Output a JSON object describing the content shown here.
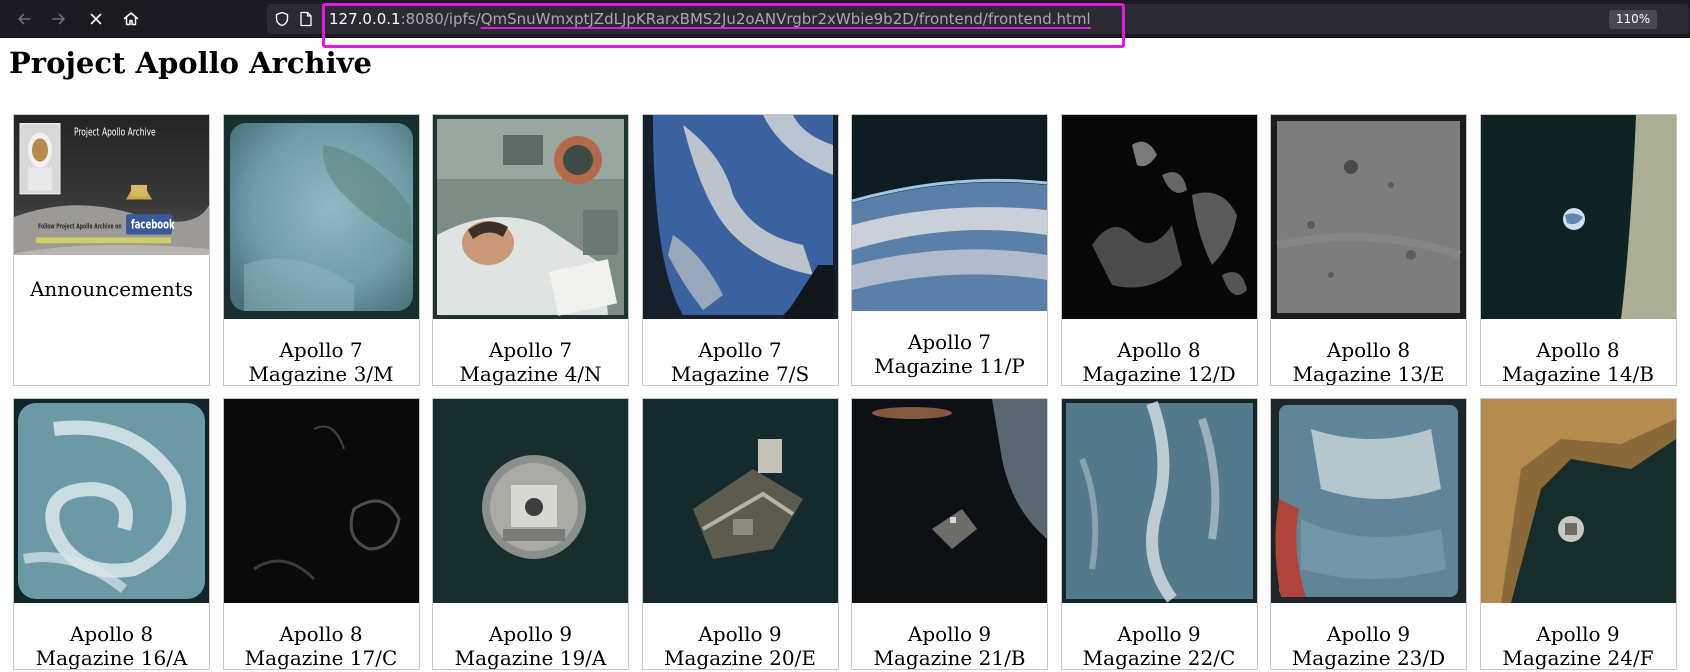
{
  "browser": {
    "url_host": "127.0.0.1",
    "url_port_prefix": ":8080/ipfs/",
    "url_path": "QmSnuWmxptJZdLJpKRarxBMS2Ju2oANVrgbr2xWbie9b2D/frontend/frontend.html",
    "zoom": "110%",
    "icons": [
      "back-arrow-icon",
      "forward-arrow-icon",
      "stop-loading-icon",
      "home-icon",
      "shield-icon",
      "page-icon"
    ]
  },
  "page": {
    "title": "Project Apollo Archive",
    "announcement": {
      "label": "Announcements",
      "banner_title": "Project Apollo Archive",
      "banner_follow": "Follow Project Apollo Archive on",
      "banner_brand": "facebook"
    },
    "albums": [
      {
        "mission": "Apollo 7",
        "magazine": "Magazine 3/M"
      },
      {
        "mission": "Apollo 7",
        "magazine": "Magazine 4/N"
      },
      {
        "mission": "Apollo 7",
        "magazine": "Magazine 7/S"
      },
      {
        "mission": "Apollo 7",
        "magazine": "Magazine 11/P"
      },
      {
        "mission": "Apollo 8",
        "magazine": "Magazine 12/D"
      },
      {
        "mission": "Apollo 8",
        "magazine": "Magazine 13/E"
      },
      {
        "mission": "Apollo 8",
        "magazine": "Magazine 14/B"
      },
      {
        "mission": "Apollo 8",
        "magazine": "Magazine 16/A"
      },
      {
        "mission": "Apollo 8",
        "magazine": "Magazine 17/C"
      },
      {
        "mission": "Apollo 9",
        "magazine": "Magazine 19/A"
      },
      {
        "mission": "Apollo 9",
        "magazine": "Magazine 20/E"
      },
      {
        "mission": "Apollo 9",
        "magazine": "Magazine 21/B"
      },
      {
        "mission": "Apollo 9",
        "magazine": "Magazine 22/C"
      },
      {
        "mission": "Apollo 9",
        "magazine": "Magazine 23/D"
      },
      {
        "mission": "Apollo 9",
        "magazine": "Magazine 24/F"
      }
    ]
  },
  "colors": {
    "toolbar_bg": "#1c1b22",
    "urlbar_bg": "#2b2a33",
    "highlight": "#e01be0",
    "card_border": "#c8c8c8"
  }
}
